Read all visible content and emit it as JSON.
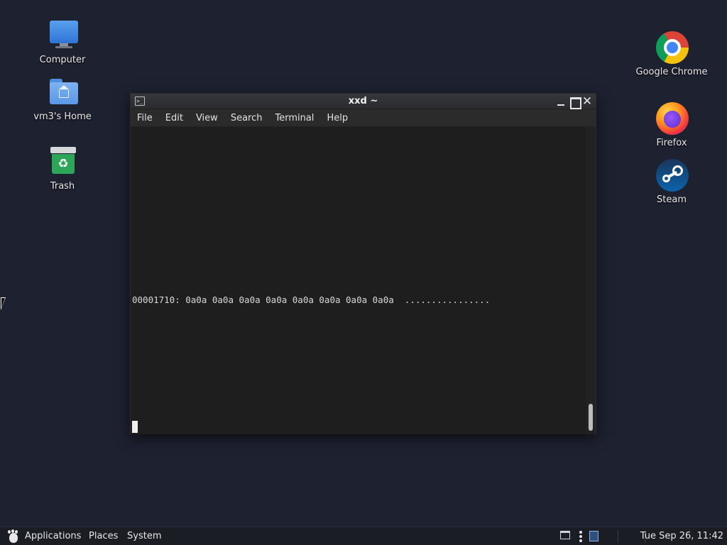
{
  "desktop": {
    "icons_left": [
      {
        "label": "Computer",
        "icon": "computer-icon"
      },
      {
        "label": "vm3's Home",
        "icon": "home-folder-icon"
      },
      {
        "label": "Trash",
        "icon": "trash-icon"
      }
    ],
    "icons_right": [
      {
        "label": "Google Chrome",
        "icon": "chrome-icon"
      },
      {
        "label": "Firefox",
        "icon": "firefox-icon"
      },
      {
        "label": "Steam",
        "icon": "steam-icon"
      }
    ]
  },
  "terminal": {
    "title": "xxd ~",
    "menu": [
      "File",
      "Edit",
      "View",
      "Search",
      "Terminal",
      "Help"
    ],
    "output_line": "00001710: 0a0a 0a0a 0a0a 0a0a 0a0a 0a0a 0a0a 0a0a  ................"
  },
  "panel": {
    "applications": "Applications",
    "places": "Places",
    "system": "System",
    "clock": "Tue Sep 26, 11:42"
  },
  "colors": {
    "desktop_bg": "#1e2130",
    "terminal_bg": "#1e1e1e",
    "panel_bg": "#1b1d25"
  }
}
